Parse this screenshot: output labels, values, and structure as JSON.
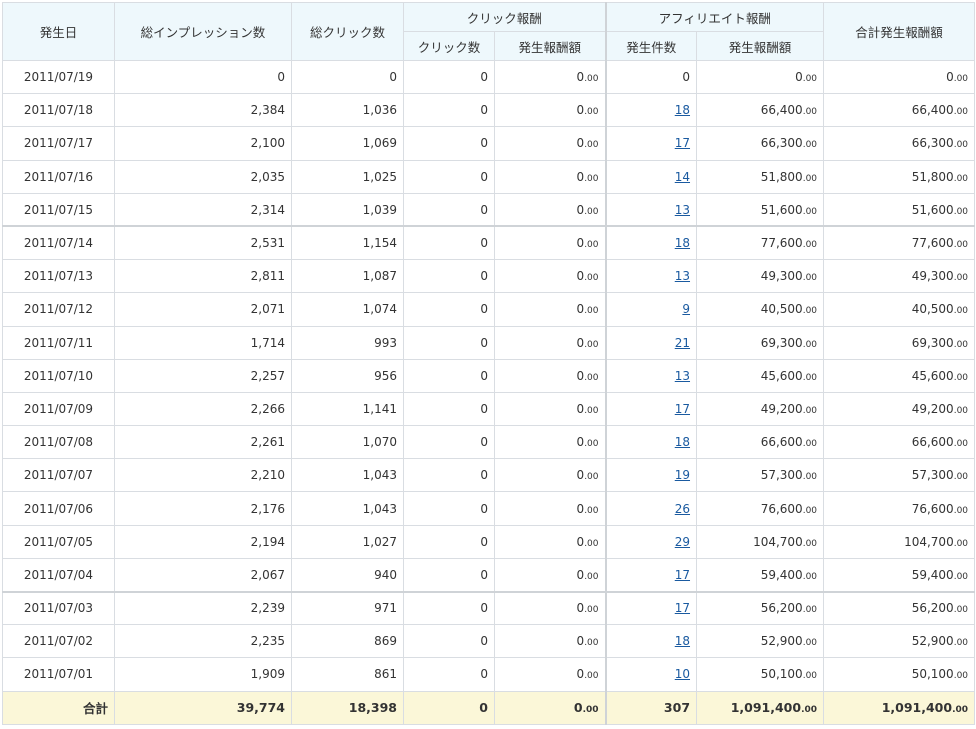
{
  "header": {
    "date": "発生日",
    "impressions": "総インプレッション数",
    "clicks": "総クリック数",
    "click_reward_group": "クリック報酬",
    "click_count": "クリック数",
    "click_amount": "発生報酬額",
    "affiliate_group": "アフィリエイト報酬",
    "aff_count": "発生件数",
    "aff_amount": "発生報酬額",
    "total_amount": "合計発生報酬額"
  },
  "rows": [
    {
      "date": "2011/07/19",
      "imp": "0",
      "clk": "0",
      "cc": "0",
      "ca": "0",
      "ca_dec": ".00",
      "ac": "0",
      "ac_link": false,
      "aa": "0",
      "aa_dec": ".00",
      "ta": "0",
      "ta_dec": ".00"
    },
    {
      "date": "2011/07/18",
      "imp": "2,384",
      "clk": "1,036",
      "cc": "0",
      "ca": "0",
      "ca_dec": ".00",
      "ac": "18",
      "ac_link": true,
      "aa": "66,400",
      "aa_dec": ".00",
      "ta": "66,400",
      "ta_dec": ".00"
    },
    {
      "date": "2011/07/17",
      "imp": "2,100",
      "clk": "1,069",
      "cc": "0",
      "ca": "0",
      "ca_dec": ".00",
      "ac": "17",
      "ac_link": true,
      "aa": "66,300",
      "aa_dec": ".00",
      "ta": "66,300",
      "ta_dec": ".00"
    },
    {
      "date": "2011/07/16",
      "imp": "2,035",
      "clk": "1,025",
      "cc": "0",
      "ca": "0",
      "ca_dec": ".00",
      "ac": "14",
      "ac_link": true,
      "aa": "51,800",
      "aa_dec": ".00",
      "ta": "51,800",
      "ta_dec": ".00"
    },
    {
      "date": "2011/07/15",
      "imp": "2,314",
      "clk": "1,039",
      "cc": "0",
      "ca": "0",
      "ca_dec": ".00",
      "ac": "13",
      "ac_link": true,
      "aa": "51,600",
      "aa_dec": ".00",
      "ta": "51,600",
      "ta_dec": ".00"
    },
    {
      "date": "2011/07/14",
      "imp": "2,531",
      "clk": "1,154",
      "cc": "0",
      "ca": "0",
      "ca_dec": ".00",
      "ac": "18",
      "ac_link": true,
      "aa": "77,600",
      "aa_dec": ".00",
      "ta": "77,600",
      "ta_dec": ".00",
      "sep": true
    },
    {
      "date": "2011/07/13",
      "imp": "2,811",
      "clk": "1,087",
      "cc": "0",
      "ca": "0",
      "ca_dec": ".00",
      "ac": "13",
      "ac_link": true,
      "aa": "49,300",
      "aa_dec": ".00",
      "ta": "49,300",
      "ta_dec": ".00"
    },
    {
      "date": "2011/07/12",
      "imp": "2,071",
      "clk": "1,074",
      "cc": "0",
      "ca": "0",
      "ca_dec": ".00",
      "ac": "9",
      "ac_link": true,
      "aa": "40,500",
      "aa_dec": ".00",
      "ta": "40,500",
      "ta_dec": ".00"
    },
    {
      "date": "2011/07/11",
      "imp": "1,714",
      "clk": "993",
      "cc": "0",
      "ca": "0",
      "ca_dec": ".00",
      "ac": "21",
      "ac_link": true,
      "aa": "69,300",
      "aa_dec": ".00",
      "ta": "69,300",
      "ta_dec": ".00"
    },
    {
      "date": "2011/07/10",
      "imp": "2,257",
      "clk": "956",
      "cc": "0",
      "ca": "0",
      "ca_dec": ".00",
      "ac": "13",
      "ac_link": true,
      "aa": "45,600",
      "aa_dec": ".00",
      "ta": "45,600",
      "ta_dec": ".00"
    },
    {
      "date": "2011/07/09",
      "imp": "2,266",
      "clk": "1,141",
      "cc": "0",
      "ca": "0",
      "ca_dec": ".00",
      "ac": "17",
      "ac_link": true,
      "aa": "49,200",
      "aa_dec": ".00",
      "ta": "49,200",
      "ta_dec": ".00"
    },
    {
      "date": "2011/07/08",
      "imp": "2,261",
      "clk": "1,070",
      "cc": "0",
      "ca": "0",
      "ca_dec": ".00",
      "ac": "18",
      "ac_link": true,
      "aa": "66,600",
      "aa_dec": ".00",
      "ta": "66,600",
      "ta_dec": ".00"
    },
    {
      "date": "2011/07/07",
      "imp": "2,210",
      "clk": "1,043",
      "cc": "0",
      "ca": "0",
      "ca_dec": ".00",
      "ac": "19",
      "ac_link": true,
      "aa": "57,300",
      "aa_dec": ".00",
      "ta": "57,300",
      "ta_dec": ".00"
    },
    {
      "date": "2011/07/06",
      "imp": "2,176",
      "clk": "1,043",
      "cc": "0",
      "ca": "0",
      "ca_dec": ".00",
      "ac": "26",
      "ac_link": true,
      "aa": "76,600",
      "aa_dec": ".00",
      "ta": "76,600",
      "ta_dec": ".00"
    },
    {
      "date": "2011/07/05",
      "imp": "2,194",
      "clk": "1,027",
      "cc": "0",
      "ca": "0",
      "ca_dec": ".00",
      "ac": "29",
      "ac_link": true,
      "aa": "104,700",
      "aa_dec": ".00",
      "ta": "104,700",
      "ta_dec": ".00"
    },
    {
      "date": "2011/07/04",
      "imp": "2,067",
      "clk": "940",
      "cc": "0",
      "ca": "0",
      "ca_dec": ".00",
      "ac": "17",
      "ac_link": true,
      "aa": "59,400",
      "aa_dec": ".00",
      "ta": "59,400",
      "ta_dec": ".00"
    },
    {
      "date": "2011/07/03",
      "imp": "2,239",
      "clk": "971",
      "cc": "0",
      "ca": "0",
      "ca_dec": ".00",
      "ac": "17",
      "ac_link": true,
      "aa": "56,200",
      "aa_dec": ".00",
      "ta": "56,200",
      "ta_dec": ".00",
      "sep": true
    },
    {
      "date": "2011/07/02",
      "imp": "2,235",
      "clk": "869",
      "cc": "0",
      "ca": "0",
      "ca_dec": ".00",
      "ac": "18",
      "ac_link": true,
      "aa": "52,900",
      "aa_dec": ".00",
      "ta": "52,900",
      "ta_dec": ".00"
    },
    {
      "date": "2011/07/01",
      "imp": "1,909",
      "clk": "861",
      "cc": "0",
      "ca": "0",
      "ca_dec": ".00",
      "ac": "10",
      "ac_link": true,
      "aa": "50,100",
      "aa_dec": ".00",
      "ta": "50,100",
      "ta_dec": ".00"
    }
  ],
  "totals": {
    "label": "合計",
    "imp": "39,774",
    "clk": "18,398",
    "cc": "0",
    "ca": "0",
    "ca_dec": ".00",
    "ac": "307",
    "aa": "1,091,400",
    "aa_dec": ".00",
    "ta": "1,091,400",
    "ta_dec": ".00"
  },
  "colors": {
    "header_bg": "#eef8fc",
    "total_bg": "#fbf7d8",
    "link": "#1a5aa0",
    "border": "#d9dde2"
  }
}
